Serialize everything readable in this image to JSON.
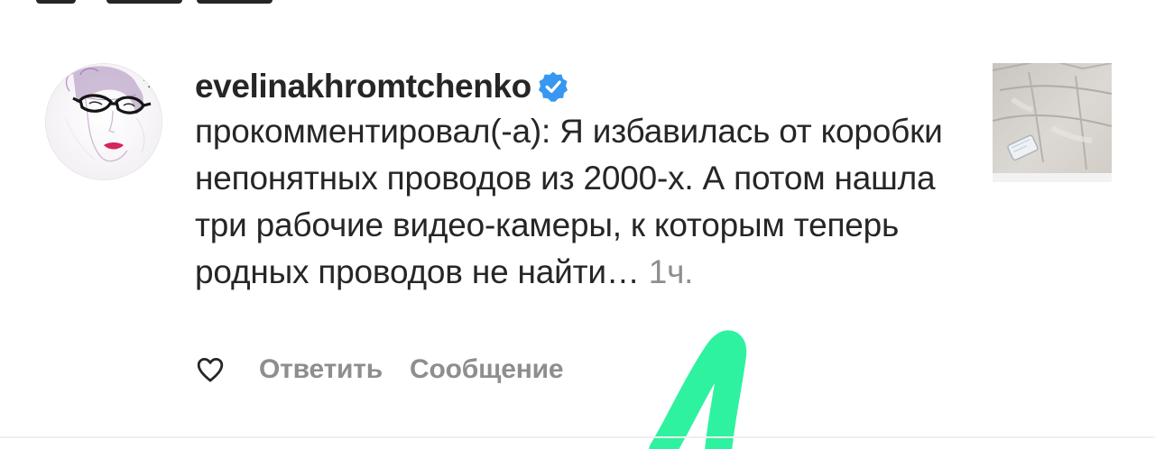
{
  "notification": {
    "username": "evelinakhromtchenko",
    "comment_text": "прокомментировал(-а): Я избавилась от коробки непонятных проводов из 2000-х. А потом нашла три рабочие видео-камеры, к которым теперь родных проводов не найти…",
    "time": "1ч.",
    "verified": true
  },
  "actions": {
    "reply_label": "Ответить",
    "message_label": "Сообщение"
  },
  "icons": {
    "avatar": "profile-illustration-icon",
    "verified": "verified-badge-icon",
    "like": "heart-outline-icon"
  },
  "colors": {
    "verified_blue": "#3897f0",
    "annotation_green": "#2ef2a0",
    "secondary_text": "#8e8e8e"
  }
}
